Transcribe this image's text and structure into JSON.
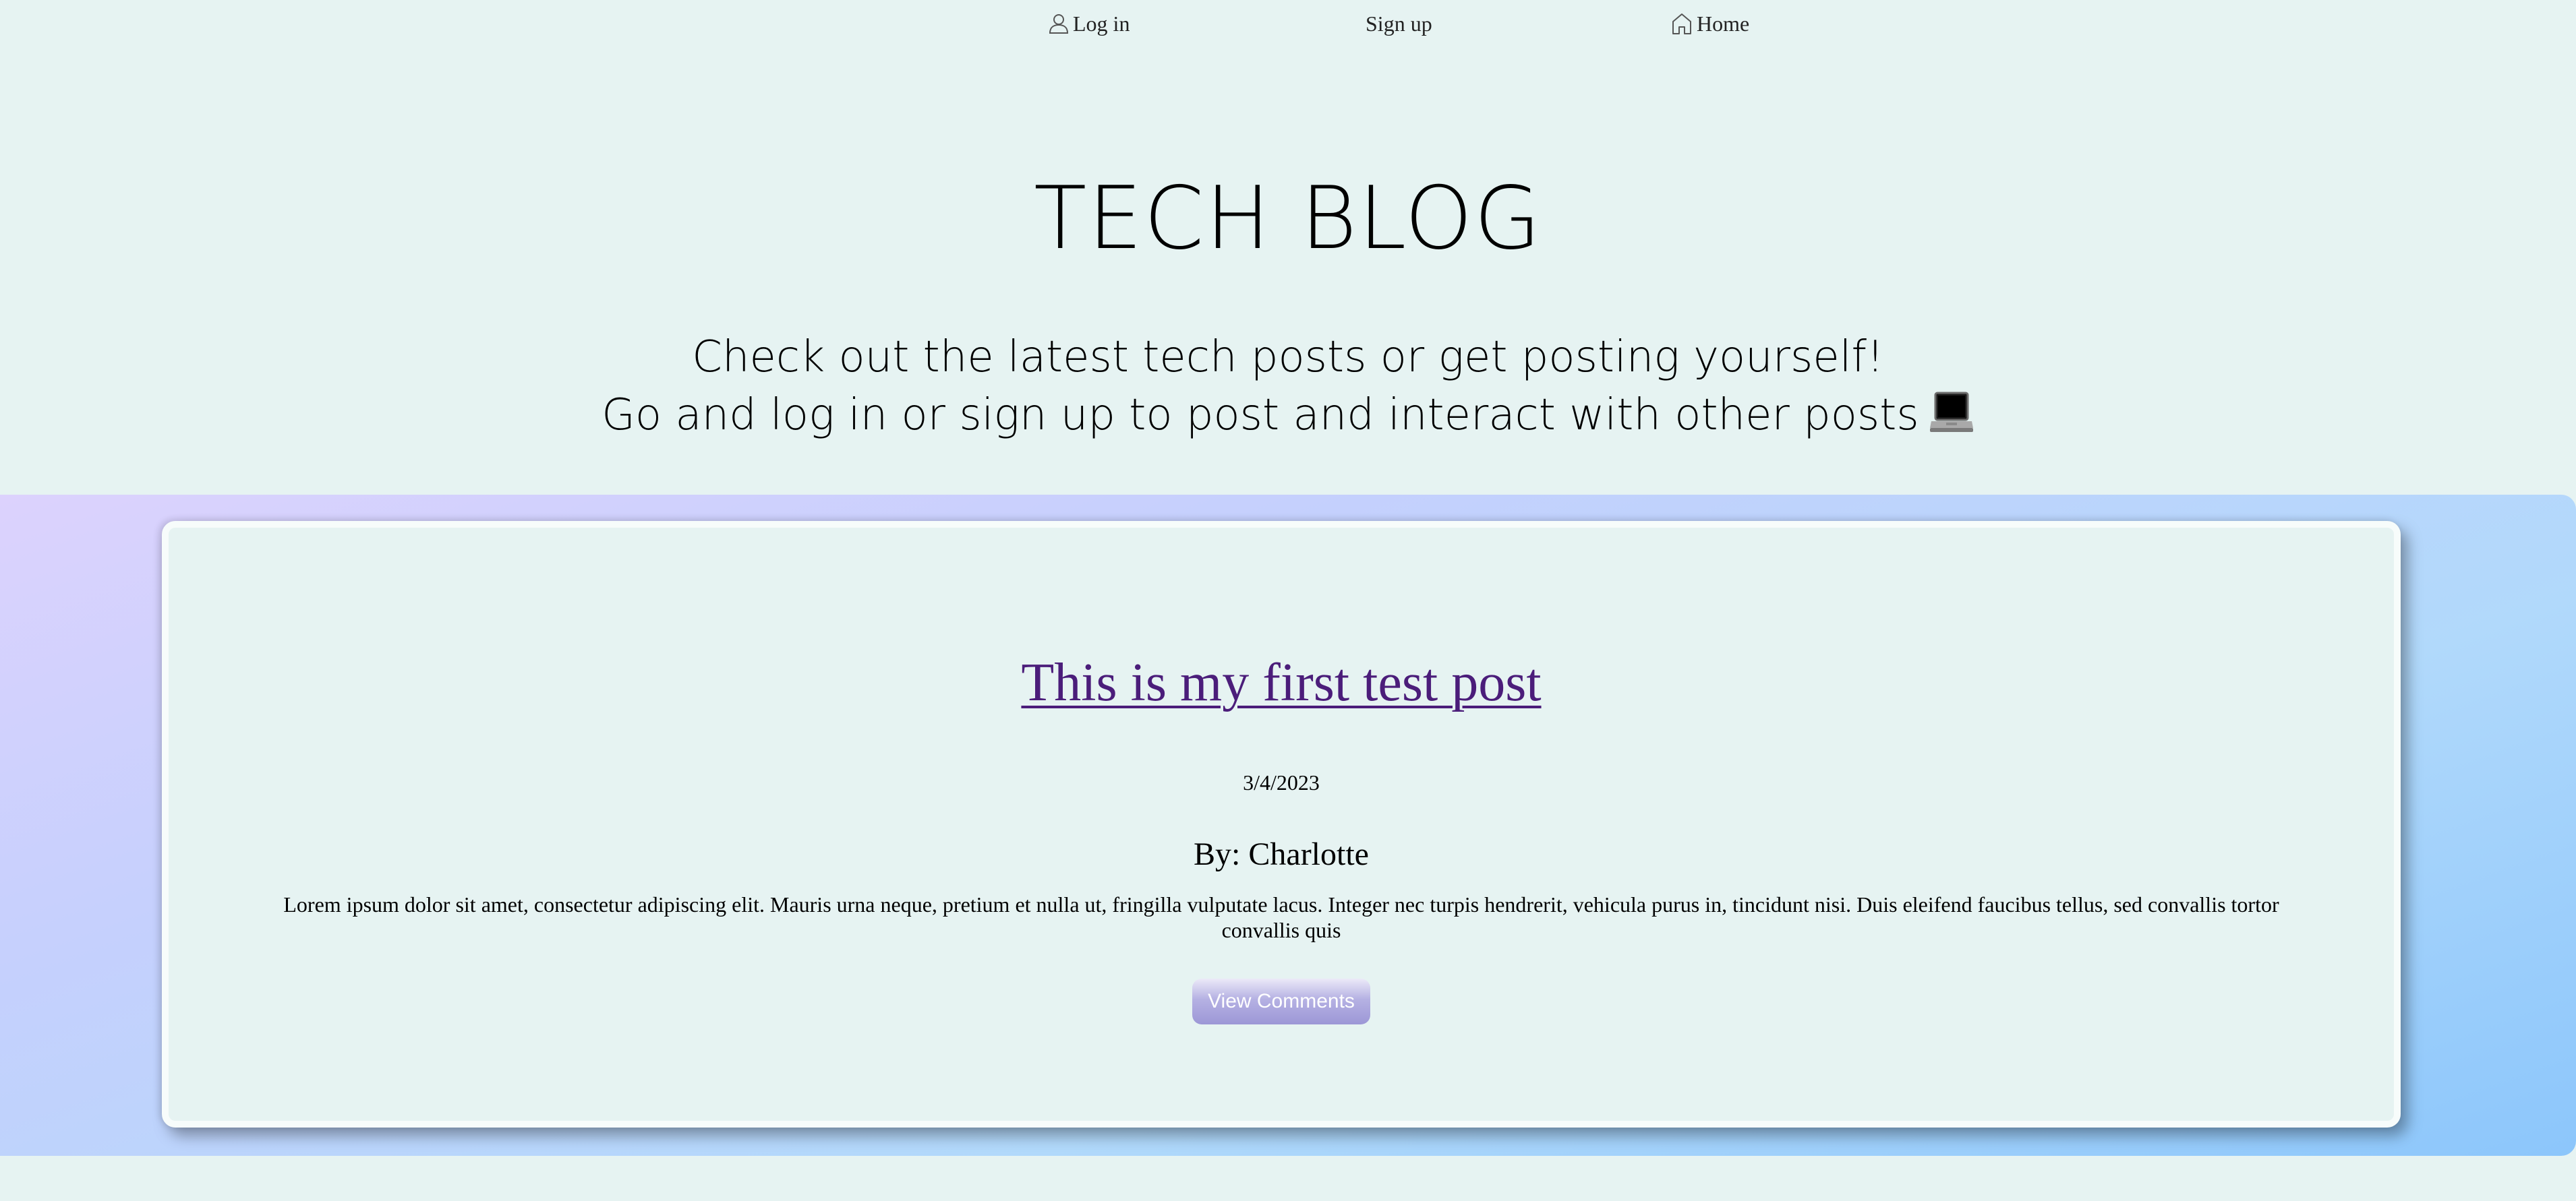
{
  "nav": {
    "items": [
      {
        "label": "Log in",
        "icon": "user-icon"
      },
      {
        "label": "Sign up",
        "icon": ""
      },
      {
        "label": "Home",
        "icon": "home-icon"
      }
    ]
  },
  "hero": {
    "title": "TECH BLOG",
    "subtitle_line1": "Check out the latest tech posts or get posting yourself!",
    "subtitle_line2": "Go and log in or sign up to post and interact with other posts",
    "subtitle_icon": "laptop-icon"
  },
  "posts": [
    {
      "title": "This is my first test post",
      "date": "3/4/2023",
      "author": "By: Charlotte",
      "body": "Lorem ipsum dolor sit amet, consectetur adipiscing elit. Mauris urna neque, pretium et nulla ut, fringilla vulputate lacus. Integer nec turpis hendrerit, vehicula purus in, tincidunt nisi. Duis eleifend faucibus tellus, sed convallis tortor convallis quis",
      "button_label": "View Comments"
    }
  ],
  "colors": {
    "page_background": "#e6f3f2",
    "post_link": "#4b1d7a",
    "gradient_start": "#dcd2fd",
    "gradient_end": "#8cc6fb",
    "button": "#9c97d6"
  }
}
